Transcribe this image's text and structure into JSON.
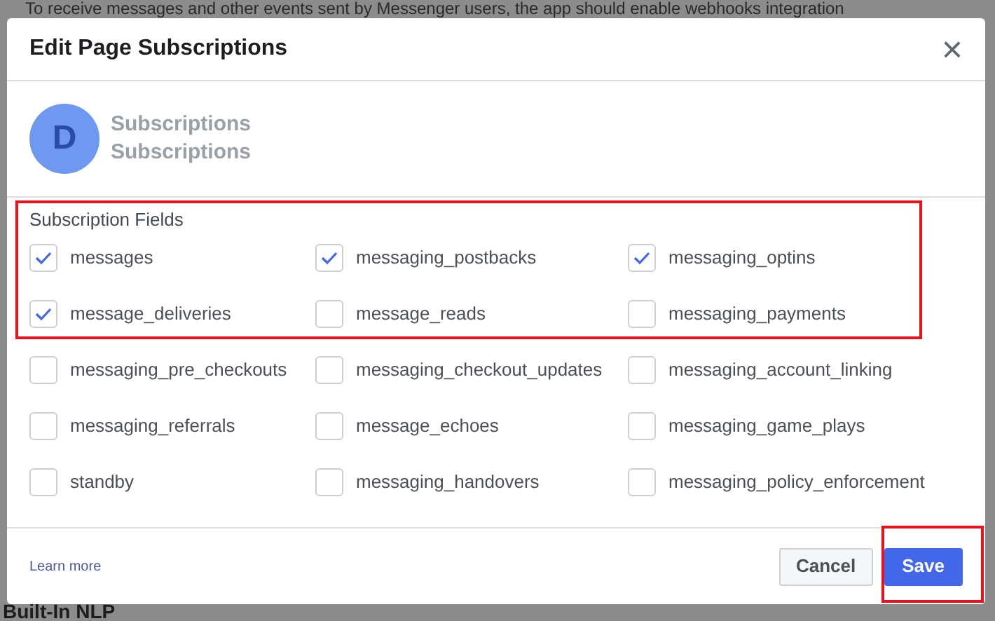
{
  "background_page": {
    "intro_text": "To receive messages and other events sent by Messenger users, the app should enable webhooks integration",
    "section_heading": "Built-In NLP"
  },
  "dialog": {
    "title": "Edit Page Subscriptions",
    "close_glyph": "×",
    "page": {
      "avatar_letter": "D",
      "name_lines": [
        "Subscriptions",
        "Subscriptions"
      ]
    },
    "fields_label": "Subscription Fields",
    "fields": [
      {
        "label": "messages",
        "checked": true
      },
      {
        "label": "messaging_postbacks",
        "checked": true
      },
      {
        "label": "messaging_optins",
        "checked": true
      },
      {
        "label": "message_deliveries",
        "checked": true
      },
      {
        "label": "message_reads",
        "checked": false
      },
      {
        "label": "messaging_payments",
        "checked": false
      },
      {
        "label": "messaging_pre_checkouts",
        "checked": false
      },
      {
        "label": "messaging_checkout_updates",
        "checked": false
      },
      {
        "label": "messaging_account_linking",
        "checked": false
      },
      {
        "label": "messaging_referrals",
        "checked": false
      },
      {
        "label": "message_echoes",
        "checked": false
      },
      {
        "label": "messaging_game_plays",
        "checked": false
      },
      {
        "label": "standby",
        "checked": false
      },
      {
        "label": "messaging_handovers",
        "checked": false
      },
      {
        "label": "messaging_policy_enforcement",
        "checked": false
      }
    ],
    "footer": {
      "link": "Learn more",
      "buttons": [
        {
          "label": "Cancel",
          "kind": "secondary"
        },
        {
          "label": "Save",
          "kind": "primary"
        }
      ]
    }
  }
}
